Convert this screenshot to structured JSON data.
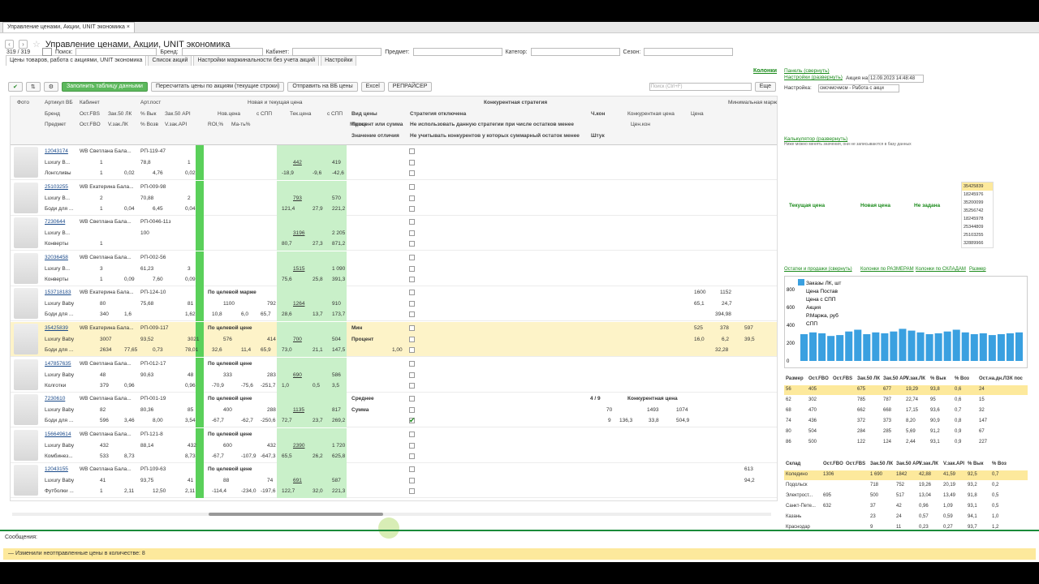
{
  "window": {
    "tab": "Управление ценами, Акции, UNIT экономика",
    "title": "Управление ценами, Акции, UNIT экономика"
  },
  "section_tabs": [
    "Цены товаров, работа с акциями, UNIT экономика",
    "Список акций",
    "Настройки маржинальности без учета акций",
    "Настройки"
  ],
  "filters": {
    "count": "319 / 319",
    "search": "Поиск:",
    "brand": "Бренд:",
    "cabinet": "Кабинет:",
    "subject": "Предмет:",
    "category": "Категор:",
    "season": "Сезон:",
    "columns_link": "Колонки"
  },
  "toolbar": {
    "fill": "Заполнить таблицу данными",
    "recalc": "Пересчитать цены по акциям (текущие строки)",
    "send": "Отправить на ВБ цены",
    "excel": "Excel",
    "repricer": "РЕПРАЙСЕР",
    "search_ph": "Поиск (Ctrl+F)",
    "more": "Еще"
  },
  "headers": {
    "photo": "Фото",
    "article": "Артикул ВБ",
    "cabinet": "Кабинет",
    "artpost": "Арт.пост",
    "brand": "Бренд",
    "ostfbs": "Ост.FBS",
    "zak50": "Зак.50 ЛК",
    "pct_buy": "% Вык",
    "zak50api": "Зак.50 API",
    "subject": "Предмет",
    "ostfbo": "Ост.FBO",
    "vzak": "V.зак.ЛК",
    "pct_ret": "% Возв",
    "vzakapi": "V.зак.API",
    "new_cur": "Новая и текущая цена",
    "new_price": "Нов.цена",
    "spp": "с СПП",
    "cur_price": "Тек.цена",
    "spp2": "с СПП",
    "roi": "ROI,%",
    "margin_pct": "Ма-ть%",
    "margin": "Маржа",
    "comp": "Конкурентная стратегия",
    "price_kind": "Вид цены",
    "strat_off": "Стратегия отключена",
    "pct_or_sum": "Процент или сумма",
    "no_use": "Не использовать данную стратегии при числе остатков менее",
    "val": "Значение отличия",
    "no_comp": "Не учитывать конкурентов у которых суммарный остаток менее",
    "chkon": "Ч.кон",
    "pcs": "Штук",
    "comp_price": "Конкурентная цена",
    "cen_kon": "Цен.кон",
    "price": "Цена",
    "min_margin": "Минимальная марж"
  },
  "rows": [
    {
      "art": "12043174",
      "cab": "WB Светлана Бала...",
      "post": "РП-119-47",
      "brand": "Luxury B...",
      "fbs": "1",
      "zak": "78,8",
      "zakapi": "1",
      "subj": "Лонгсливы",
      "fbo": "1",
      "vzak": "0,02",
      "ret": "4,76",
      "vapi": "0,02",
      "cur": "442",
      "cur2": "419",
      "roi": "-18,9",
      "mt": "-9,6",
      "mg": "-42,6"
    },
    {
      "art": "25103255",
      "cab": "WB Екатерина Бала...",
      "post": "РП-009-98",
      "brand": "Luxury B...",
      "fbs": "2",
      "zak": "70,88",
      "zakapi": "2",
      "subj": "Боди для ...",
      "fbo": "1",
      "vzak": "0,04",
      "ret": "6,45",
      "vapi": "0,04",
      "cur": "793",
      "cur2": "570",
      "roi": "121,4",
      "mt": "27,9",
      "mg": "221,2"
    },
    {
      "art": "7230644",
      "cab": "WB Светлана Бала...",
      "post": "РП-0046-11з",
      "brand": "Luxury B...",
      "fbs": "",
      "zak": "100",
      "zakapi": "",
      "subj": "Конверты",
      "fbo": "1",
      "vzak": "",
      "ret": "",
      "vapi": "",
      "cur": "3196",
      "cur2": "2 205",
      "roi": "80,7",
      "mt": "27,3",
      "mg": "871,2"
    },
    {
      "art": "32036458",
      "cab": "WB Светлана Бала...",
      "post": "РП-002-56",
      "brand": "Luxury B...",
      "fbs": "3",
      "zak": "61,23",
      "zakapi": "3",
      "subj": "Конверты",
      "fbo": "1",
      "vzak": "0,09",
      "ret": "7,60",
      "vapi": "0,09",
      "cur": "1515",
      "cur2": "1 090",
      "roi": "75,6",
      "mt": "25,8",
      "mg": "391,3"
    },
    {
      "art": "153718183",
      "cab": "WB Екатерина Бала...",
      "post": "РП-124-10",
      "brand": "Luxury Baby",
      "fbs": "80",
      "zak": "75,68",
      "zakapi": "81",
      "subj": "Боди для ...",
      "fbo": "340",
      "vzak": "1,6",
      "ret": "",
      "vapi": "1,62",
      "kind": "По целевой марже",
      "np": "1100",
      "np2": "792",
      "r1": "10,8",
      "m1": "6,0",
      "g1": "65,7",
      "cur": "1264",
      "cur2": "910",
      "roi": "28,6",
      "mt": "13,7",
      "mg": "173,7",
      "p1": "1600",
      "p2": "1152",
      "p3": "65,1",
      "p4": "24,7",
      "p5": "394,98"
    },
    {
      "art": "35425839",
      "cab": "WB Екатерина Бала...",
      "post": "РП-009-117",
      "brand": "Luxury Baby",
      "fbs": "3007",
      "zak": "93,52",
      "zakapi": "3021",
      "subj": "Боди для ...",
      "fbo": "2634",
      "vzak": "77,65",
      "ret": "0,73",
      "vapi": "78,01",
      "kind": "По целевой цене",
      "np": "576",
      "np2": "414",
      "r1": "32,6",
      "m1": "11,4",
      "g1": "65,9",
      "cur": "700",
      "cur2": "504",
      "roi": "73,0",
      "mt": "21,1",
      "mg": "147,5",
      "sel": true,
      "vid": "Мин",
      "proc": "Процент",
      "znach": "1,00",
      "p1": "525",
      "p2": "378",
      "p6": "597",
      "p3": "16,0",
      "p4": "6,2",
      "p7": "39,5",
      "p5": "32,28"
    },
    {
      "art": "147857635",
      "cab": "WB Светлана Бала...",
      "post": "РП-012-17",
      "brand": "Luxury Baby",
      "fbs": "48",
      "zak": "90,63",
      "zakapi": "48",
      "subj": "Колготки",
      "fbo": "379",
      "vzak": "0,96",
      "ret": "",
      "vapi": "0,96",
      "kind": "По целевой цене",
      "np": "333",
      "np2": "283",
      "r1": "-70,9",
      "m1": "-75,6",
      "g1": "-251,7",
      "cur": "690",
      "cur2": "586",
      "roi": "1,0",
      "mt": "0,5",
      "mg": "3,5"
    },
    {
      "art": "7230610",
      "cab": "WB Светлана Бала...",
      "post": "РП-001-19",
      "brand": "Luxury Baby",
      "fbs": "82",
      "zak": "80,36",
      "zakapi": "85",
      "subj": "Боди для ...",
      "fbo": "596",
      "vzak": "3,46",
      "ret": "8,00",
      "vapi": "3,54",
      "kind": "По целевой цене",
      "np": "400",
      "np2": "288",
      "r1": "-67,7",
      "m1": "-62,7",
      "g1": "-250,6",
      "cur": "1135",
      "cur2": "817",
      "roi": "72,7",
      "mt": "23,7",
      "mg": "269,2",
      "vid": "Среднее",
      "proc": "Сумма",
      "ck": "4 / 9",
      "cp": "Конкурентная цена",
      "c70": "70",
      "c1493": "1493",
      "c1074": "1074",
      "c9": "9",
      "c136": "136,3",
      "c33": "33,8",
      "c504": "504,9",
      "checked": true
    },
    {
      "art": "156649614",
      "cab": "WB Светлана Бала...",
      "post": "РП-121-8",
      "brand": "Luxury Baby",
      "fbs": "432",
      "zak": "88,14",
      "zakapi": "432",
      "subj": "Комбинез...",
      "fbo": "533",
      "vzak": "8,73",
      "ret": "",
      "vapi": "8,73",
      "kind": "По целевой цене",
      "np": "600",
      "np2": "432",
      "r1": "-67,7",
      "m1": "-107,9",
      "g1": "-647,3",
      "cur": "2390",
      "cur2": "1 720",
      "roi": "65,5",
      "mt": "26,2",
      "mg": "625,8"
    },
    {
      "art": "12043155",
      "cab": "WB Светлана Бала...",
      "post": "РП-109-63",
      "brand": "Luxury Baby",
      "fbs": "41",
      "zak": "93,75",
      "zakapi": "41",
      "subj": "Футболки ...",
      "fbo": "1",
      "vzak": "2,11",
      "ret": "12,50",
      "vapi": "2,11",
      "kind": "По целевой цене",
      "np": "88",
      "np2": "74",
      "r1": "-114,4",
      "m1": "-234,0",
      "g1": "-197,6",
      "cur": "691",
      "cur2": "587",
      "roi": "122,7",
      "mt": "32,0",
      "mg": "221,3",
      "p6": "613",
      "p7": "94,2"
    }
  ],
  "right": {
    "panel_link": "Панель (свернуть)",
    "settings_link": "Настройки (развернуть)",
    "promo_label": "Акция на:",
    "promo_date": "12.09.2023 14:48:48",
    "setting": "Настройка:",
    "setting_val": "смсчмсчмсм - Работа с акци",
    "calc_link": "Калькулятор (развернуть)",
    "calc_note": "Ниже можно менять значения, они не записываются в базу данных",
    "cur_price": "Текущая цена",
    "new_price": "Новая цена",
    "no_task": "Не задана",
    "stock_link": "Остатки и продажи (свернуть)",
    "by_size": "Колонки по РАЗМЕРАМ",
    "by_wh": "Колонки по СКЛАДАМ",
    "razm": "Размер",
    "articles": [
      "35425839",
      "18245976",
      "35200099",
      "35256742",
      "18245978",
      "25344809",
      "25103255",
      "32889966"
    ],
    "legend": [
      "Заказы ЛК, шт",
      "Цена Постав",
      "Цена с СПП",
      "Акция",
      "Р.Маржа, руб",
      "СПП"
    ],
    "yticks": [
      "800",
      "600",
      "400",
      "200",
      "0"
    ],
    "size_head": [
      "Размер",
      "Ост.FBO",
      "Ост.FBS",
      "Зак.50 ЛК",
      "Зак.50 API",
      "V.зак.ЛК",
      "% Вык",
      "% Воз",
      "Ост.на.дн.ЛЗ",
      "К пос"
    ],
    "sizes": [
      [
        "56",
        "405",
        "",
        "675",
        "677",
        "19,29",
        "93,8",
        "0,6",
        "24"
      ],
      [
        "62",
        "302",
        "",
        "785",
        "787",
        "22,74",
        "95",
        "0,6",
        "15"
      ],
      [
        "68",
        "470",
        "",
        "662",
        "668",
        "17,15",
        "93,6",
        "0,7",
        "32"
      ],
      [
        "74",
        "436",
        "",
        "372",
        "373",
        "8,20",
        "90,9",
        "0,8",
        "147"
      ],
      [
        "80",
        "504",
        "",
        "284",
        "285",
        "5,69",
        "91,2",
        "0,9",
        "67"
      ],
      [
        "86",
        "500",
        "",
        "122",
        "124",
        "2,44",
        "93,1",
        "0,9",
        "227"
      ]
    ],
    "wh_head": [
      "Склад",
      "Ост.FBO",
      "Ост.FBS",
      "Зак.50 ЛК",
      "Зак.50 API",
      "V.зак.ЛК",
      "V.зак.API",
      "% Вык",
      "% Воз"
    ],
    "whs": [
      [
        "Коледино",
        "1306",
        "",
        "1 690",
        "1842",
        "42,88",
        "41,59",
        "92,5",
        "0,7"
      ],
      [
        "Подольск",
        "",
        "",
        "718",
        "752",
        "19,26",
        "20,19",
        "93,2",
        "0,2"
      ],
      [
        "Электрост...",
        "695",
        "",
        "500",
        "517",
        "13,04",
        "13,49",
        "91,8",
        "0,5"
      ],
      [
        "Санкт-Пете...",
        "632",
        "",
        "37",
        "42",
        "0,96",
        "1,09",
        "93,1",
        "0,5"
      ],
      [
        "Казань",
        "",
        "",
        "23",
        "24",
        "0,57",
        "0,59",
        "94,1",
        "1,0"
      ],
      [
        "Краснодар",
        "",
        "",
        "9",
        "11",
        "0,23",
        "0,27",
        "93,7",
        "1,2"
      ]
    ]
  },
  "messages": {
    "title": "Сообщения:",
    "text": "Изменили неотправленные цены в количестве: 8"
  },
  "chart_data": {
    "type": "line",
    "series": [
      {
        "name": "Заказы ЛК, шт",
        "values": [
          300,
          320,
          310,
          280,
          290,
          330,
          350,
          300,
          320,
          310,
          330,
          360,
          340,
          320,
          300,
          310,
          330,
          350,
          320,
          300,
          310,
          290,
          300,
          310,
          320
        ]
      }
    ],
    "ylim": [
      0,
      800
    ]
  }
}
